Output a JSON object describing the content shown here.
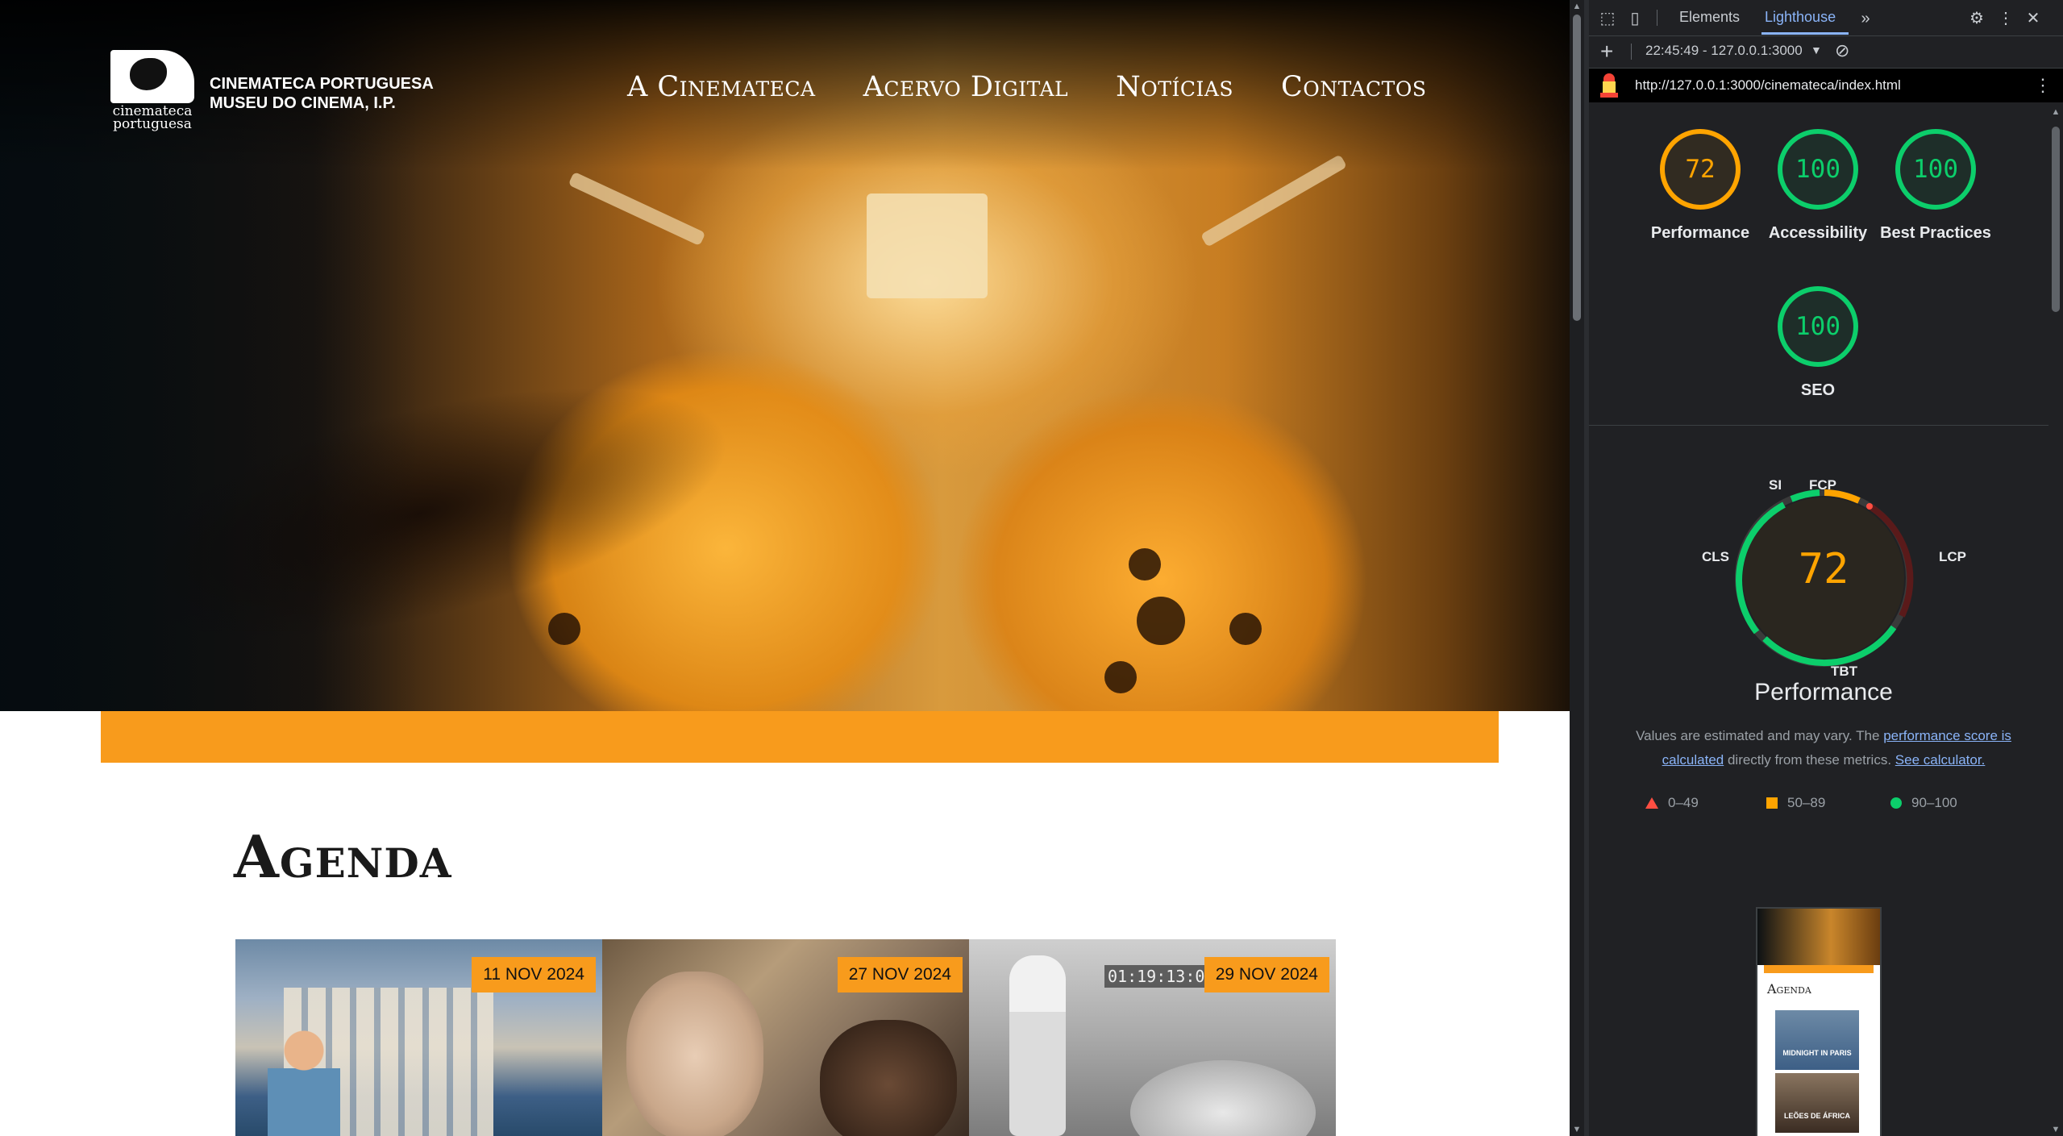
{
  "site": {
    "logo_text_1": "cinemateca",
    "logo_text_2": "portuguesa",
    "org_line_1": "CINEMATECA PORTUGUESA",
    "org_line_2": "MUSEU DO CINEMA, I.P.",
    "nav": [
      "A Cinemateca",
      "Acervo Digital",
      "Notícias",
      "Contactos"
    ],
    "agenda_title": "Agenda",
    "cards": [
      {
        "date": "11 NOV 2024"
      },
      {
        "date": "27 NOV 2024",
        "timecode": ""
      },
      {
        "date": "29 NOV 2024",
        "timecode": "01:19:13:05"
      }
    ],
    "accent_color": "#f89b1c"
  },
  "devtools": {
    "tabs": [
      "Elements",
      "Lighthouse"
    ],
    "active_tab": "Lighthouse",
    "report_label": "22:45:49 - 127.0.0.1:3000",
    "url": "http://127.0.0.1:3000/cinemateca/index.html",
    "scores": [
      {
        "value": "72",
        "label": "Performance",
        "status": "orange"
      },
      {
        "value": "100",
        "label": "Accessibility",
        "status": "green"
      },
      {
        "value": "100",
        "label": "Best Practices",
        "status": "green"
      },
      {
        "value": "100",
        "label": "SEO",
        "status": "green"
      }
    ],
    "performance": {
      "score": "72",
      "title": "Performance",
      "metrics": [
        "SI",
        "FCP",
        "LCP",
        "TBT",
        "CLS"
      ],
      "note_prefix": "Values are estimated and may vary. The ",
      "note_link_1": "performance score is calculated",
      "note_mid": " directly from these metrics. ",
      "note_link_2": "See calculator."
    },
    "legend": [
      "0–49",
      "50–89",
      "90–100"
    ],
    "thumbnail": {
      "title": "Agenda",
      "card_1": "MIDNIGHT IN PARIS",
      "card_2": "LEÕES DE ÁFRICA"
    },
    "colors": {
      "fail": "#ff4e42",
      "average": "#ffa400",
      "pass": "#0cce6b",
      "link": "#8ab4f8"
    }
  }
}
